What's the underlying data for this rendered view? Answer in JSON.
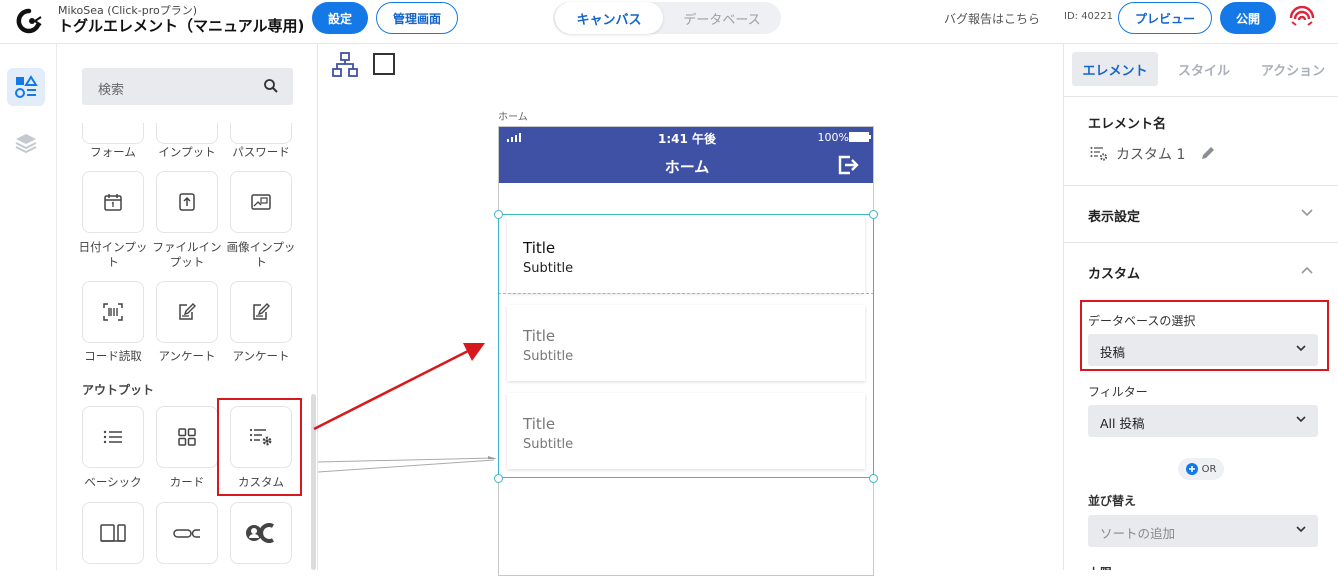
{
  "header": {
    "project_sub": "MikoSea (Click-proプラン)",
    "project_title": "トグルエレメント（マニュアル専用)",
    "settings_label": "設定",
    "admin_label": "管理画面",
    "tab_canvas": "キャンバス",
    "tab_database": "データベース",
    "bug_report": "バグ報告はこちら",
    "project_id": "ID: 40221",
    "preview_label": "プレビュー",
    "publish_label": "公開"
  },
  "palette": {
    "search_placeholder": "検索",
    "row0": [
      "フォーム",
      "インプット",
      "パスワード"
    ],
    "row1": [
      "日付インプット",
      "ファイルインプット",
      "画像インプット"
    ],
    "row2": [
      "コード読取",
      "アンケート",
      "アンケート"
    ],
    "output_section": "アウトプット",
    "row3": [
      "ベーシック",
      "カード",
      "カスタム"
    ]
  },
  "canvas": {
    "screen_label": "ホーム",
    "status_time": "1:41 午後",
    "status_battery": "100%",
    "appbar_title": "ホーム",
    "cards": [
      {
        "title": "Title",
        "subtitle": "Subtitle"
      },
      {
        "title": "Title",
        "subtitle": "Subtitle"
      },
      {
        "title": "Title",
        "subtitle": "Subtitle"
      }
    ]
  },
  "panel": {
    "tabs": [
      "エレメント",
      "スタイル",
      "アクション"
    ],
    "element_name_heading": "エレメント名",
    "element_name_value": "カスタム 1",
    "display_settings": "表示設定",
    "custom_heading": "カスタム",
    "db_select_label": "データベースの選択",
    "db_select_value": "投稿",
    "filter_label": "フィルター",
    "filter_value": "All 投稿",
    "or_label": "OR",
    "sort_label": "並び替え",
    "sort_placeholder": "ソートの追加",
    "limit_label": "上限"
  },
  "colors": {
    "accent": "#1479e6",
    "appbar": "#3f51a5",
    "highlight": "#d7191e",
    "selection": "#3db6c9"
  }
}
